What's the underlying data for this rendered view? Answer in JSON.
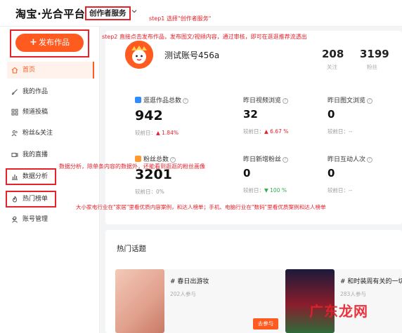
{
  "header": {
    "logo": "淘宝·光合平台",
    "creator_service": "创作者服务",
    "step1_note": "step1 选择\"创作者服务\""
  },
  "sidebar": {
    "publish_label": "发布作品",
    "items": [
      {
        "label": "首页",
        "icon": "home-icon"
      },
      {
        "label": "我的作品",
        "icon": "brush-icon"
      },
      {
        "label": "频道投稿",
        "icon": "grid-icon"
      },
      {
        "label": "粉丝&关注",
        "icon": "users-icon"
      },
      {
        "label": "我的直播",
        "icon": "video-icon"
      },
      {
        "label": "数据分析",
        "icon": "bar-chart-icon"
      },
      {
        "label": "热门榜单",
        "icon": "flame-icon"
      },
      {
        "label": "账号管理",
        "icon": "user-icon"
      }
    ]
  },
  "step2_note": "step2 直接点击发布作品，发布图文/视频内容，通过审核，即可在逛逛推荐流透出",
  "account": {
    "name": "测试账号456a",
    "following_value": "208",
    "following_label": "关注",
    "fans_value": "3199",
    "fans_label": "粉丝"
  },
  "metrics": [
    {
      "title": "逛逛作品总数",
      "value": "942",
      "cmp_label": "较前日：",
      "cmp_value": "1.84%",
      "trend": "up"
    },
    {
      "title": "昨日视频浏览",
      "value": "32",
      "cmp_label": "较前日：",
      "cmp_value": "6.67 %",
      "trend": "up"
    },
    {
      "title": "昨日图文浏览",
      "value": "0",
      "cmp_label": "较前日：",
      "cmp_value": "--",
      "trend": "none"
    },
    {
      "title": "粉丝总数",
      "value": "3201",
      "cmp_label": "较前日：",
      "cmp_value": "0%",
      "trend": "none"
    },
    {
      "title": "昨日新增粉丝",
      "value": "0",
      "cmp_label": "较前日：",
      "cmp_value": "100 %",
      "trend": "down"
    },
    {
      "title": "昨日互动人次",
      "value": "0",
      "cmp_label": "较前日：",
      "cmp_value": "--",
      "trend": "none"
    }
  ],
  "notes": {
    "data_analysis": "数据分析，除单条内容的数据外，还能看到逛逛的粉丝画像",
    "hot_list": "大小家电行业在\"家居\"里看优质内容案例，和达人榜单；手机、电脑行业在\"数码\"里看优质案例和达人榜单"
  },
  "hot": {
    "title": "热门话题",
    "topics": [
      {
        "name": "#  春日出游妆",
        "count": "202人参与",
        "button": "去参与"
      },
      {
        "name": "#  和时装周有关的一切",
        "count": "283人参与"
      }
    ]
  },
  "watermark": "广东龙网",
  "colors": {
    "accent": "#ff5a1f",
    "annotation_red": "#e8202a"
  }
}
